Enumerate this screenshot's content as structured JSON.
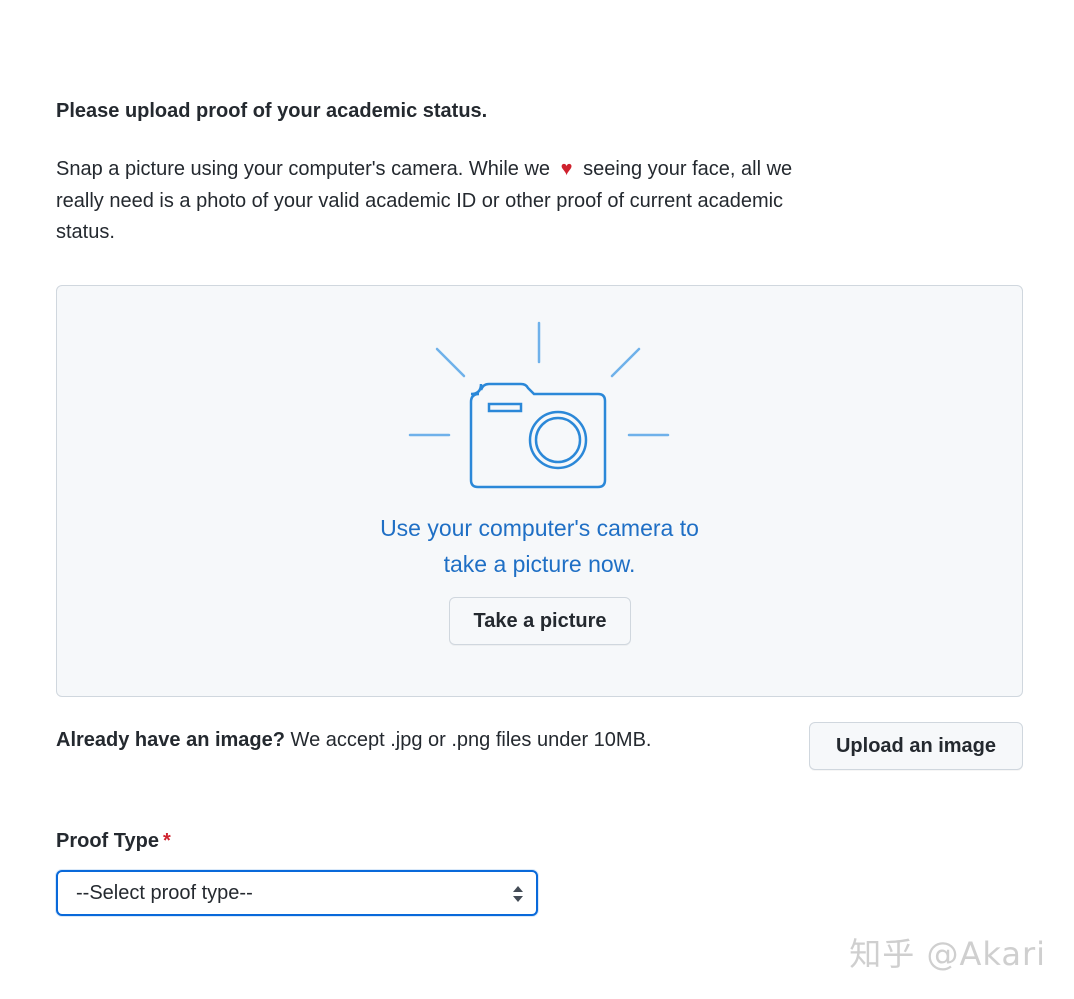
{
  "heading": "Please upload proof of your academic status.",
  "intro": {
    "before_heart": "Snap a picture using your computer's camera. While we",
    "heart_glyph": "♥",
    "after_heart": "seeing your face, all we really need is a photo of your valid academic ID or other proof of current academic status."
  },
  "camera_panel": {
    "caption_line1": "Use your computer's camera to",
    "caption_line2": "take a picture now.",
    "take_picture_label": "Take a picture",
    "icon": "camera-icon",
    "accent_color": "#2b88d8"
  },
  "upload": {
    "question": "Already have an image?",
    "note": "We accept .jpg or .png files under 10MB.",
    "button_label": "Upload an image"
  },
  "proof_type": {
    "label": "Proof Type",
    "required_marker": "*",
    "selected_value": "--Select proof type--"
  },
  "watermark": "知乎 @Akari",
  "colors": {
    "text": "#24292f",
    "link_blue": "#1f6fc5",
    "required_red": "#cf222e",
    "focus_blue": "#0969da",
    "panel_bg": "#f6f8fa"
  }
}
